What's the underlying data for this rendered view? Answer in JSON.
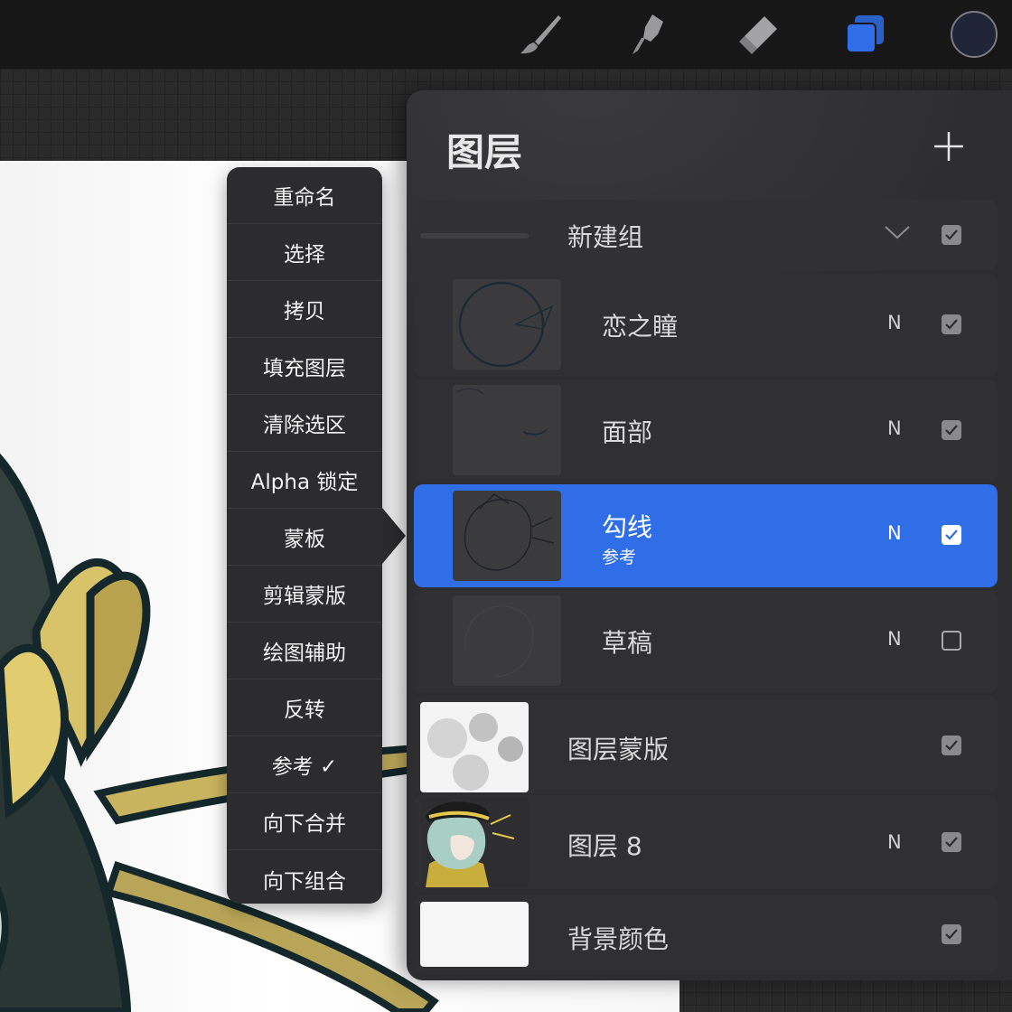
{
  "toolbar": {
    "tools": [
      {
        "icon": "brush-icon"
      },
      {
        "icon": "smudge-icon"
      },
      {
        "icon": "eraser-icon"
      },
      {
        "icon": "layers-icon",
        "active": true,
        "color": "#2f6ee6"
      }
    ],
    "color_swatch": "#1f2437"
  },
  "menu": {
    "items": [
      "重命名",
      "选择",
      "拷贝",
      "填充图层",
      "清除选区",
      "Alpha 锁定",
      "蒙板",
      "剪辑蒙版",
      "绘图辅助",
      "反转",
      "参考 ✓",
      "向下合并",
      "向下组合"
    ]
  },
  "panel": {
    "title": "图层",
    "add_icon": "plus-icon",
    "group": {
      "name": "新建组",
      "visible": true
    },
    "layers": [
      {
        "name": "恋之瞳",
        "blend": "N",
        "visible": true,
        "sub": ""
      },
      {
        "name": "面部",
        "blend": "N",
        "visible": true,
        "sub": ""
      },
      {
        "name": "勾线",
        "blend": "N",
        "visible": true,
        "sub": "参考",
        "selected": true
      },
      {
        "name": "草稿",
        "blend": "N",
        "visible": false,
        "sub": ""
      }
    ],
    "top_layers": [
      {
        "name": "图层蒙版",
        "blend": "",
        "visible": true
      },
      {
        "name": "图层 8",
        "blend": "N",
        "visible": true
      },
      {
        "name": "背景颜色",
        "blend": "",
        "visible": true
      }
    ]
  },
  "colors": {
    "accent": "#2f6ee6",
    "panel": "#2d2d2f",
    "menu": "#2c2c2e"
  }
}
